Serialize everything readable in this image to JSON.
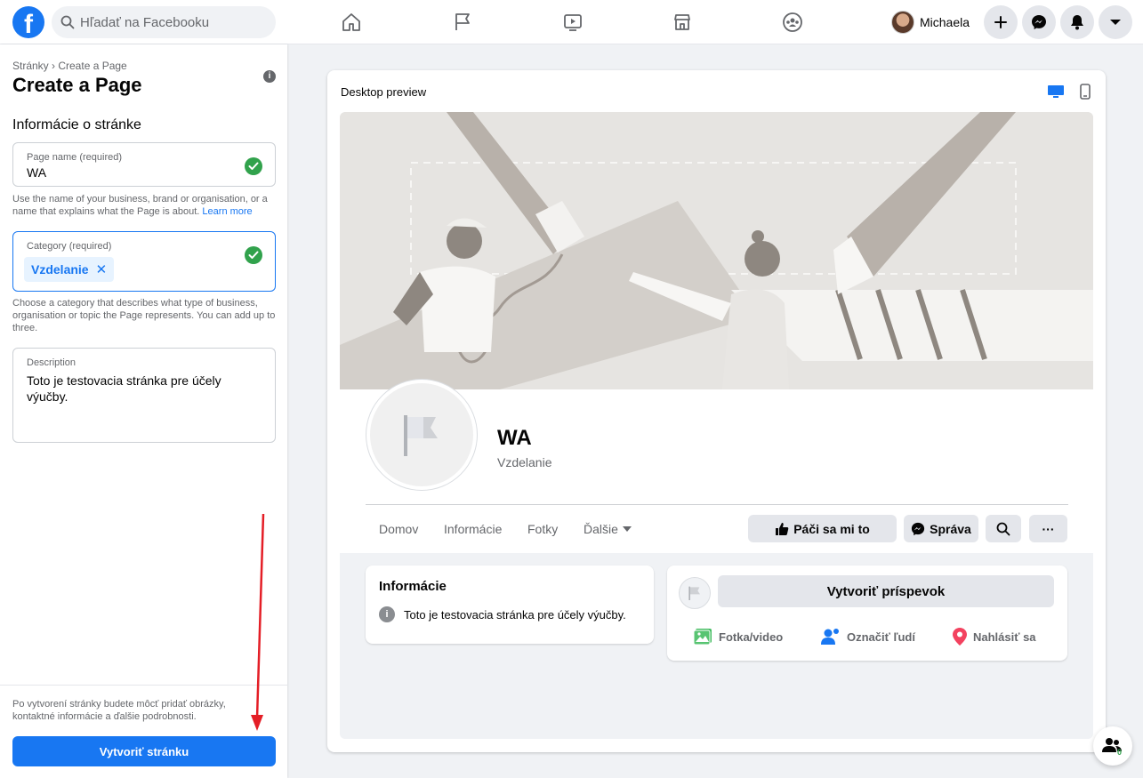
{
  "topbar": {
    "logo": "f",
    "search_placeholder": "Hľadať na Facebooku",
    "user_name": "Michaela",
    "nav_icons": [
      "home-icon",
      "flag-icon",
      "video-icon",
      "marketplace-icon",
      "groups-icon"
    ],
    "action_icons": [
      "plus-icon",
      "messenger-icon",
      "bell-icon",
      "caret-down-icon"
    ]
  },
  "left": {
    "breadcrumb": "Stránky › Create a Page",
    "title": "Create a Page",
    "section_title": "Informácie o stránke",
    "page_name": {
      "label": "Page name (required)",
      "value": "WA",
      "help": "Use the name of your business, brand or organisation, or a name that explains what the Page is about.",
      "learn_more": "Learn more"
    },
    "category": {
      "label": "Category (required)",
      "chip": "Vzdelanie",
      "chip_remove": "✕",
      "help": "Choose a category that describes what type of business, organisation or topic the Page represents. You can add up to three."
    },
    "description": {
      "label": "Description",
      "value": "Toto je testovacia stránka pre účely výučby."
    },
    "footer_note": "Po vytvorení stránky budete môcť pridať obrázky, kontaktné informácie a ďalšie podrobnosti.",
    "create_button": "Vytvoriť stránku"
  },
  "preview": {
    "title": "Desktop preview",
    "page_name": "WA",
    "page_category": "Vzdelanie",
    "tabs": [
      "Domov",
      "Informácie",
      "Fotky",
      "Ďalšie"
    ],
    "buttons": {
      "like": "Páči sa mi to",
      "message": "Správa",
      "more": "···"
    },
    "info_card": {
      "title": "Informácie",
      "text": "Toto je testovacia stránka pre účely výučby."
    },
    "post_card": {
      "create_post": "Vytvoriť príspevok",
      "options": [
        "Fotka/video",
        "Označiť ľudí",
        "Nahlásiť sa"
      ]
    }
  },
  "people_badge": "0",
  "colors": {
    "accent": "#1877f2",
    "check": "#31a24c",
    "arrow": "#e41e26"
  }
}
